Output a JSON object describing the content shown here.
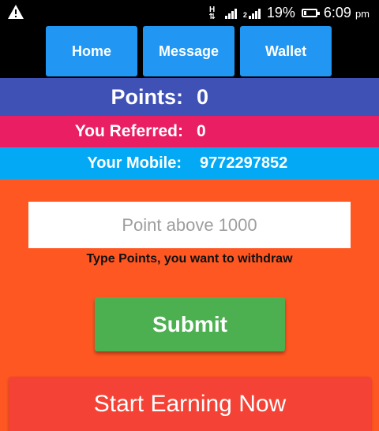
{
  "status_bar": {
    "network_type": "H",
    "battery": "19%",
    "battery_level": 0.19,
    "time": "6:09",
    "time_suffix": "pm",
    "sim2_label": "2"
  },
  "nav": {
    "home_label": "Home",
    "message_label": "Message",
    "wallet_label": "Wallet"
  },
  "stats": {
    "points_label": "Points:",
    "points_value": "0",
    "referred_label": "You Referred:",
    "referred_value": "0",
    "mobile_label": "Your Mobile:",
    "mobile_value": "9772297852"
  },
  "withdraw": {
    "input_placeholder": "Point above 1000",
    "input_value": "",
    "hint": "Type Points, you want to withdraw",
    "submit_label": "Submit"
  },
  "earn_button_label": "Start Earning Now",
  "colors": {
    "nav_button": "#2196f3",
    "points_band": "#3f51b5",
    "referred_band": "#e91e63",
    "mobile_band": "#03a9f4",
    "background": "#ff5722",
    "submit": "#4caf50",
    "earn": "#f44336"
  },
  "icons": [
    "warning-icon",
    "network-arrows-icon",
    "signal-icon",
    "battery-icon"
  ]
}
